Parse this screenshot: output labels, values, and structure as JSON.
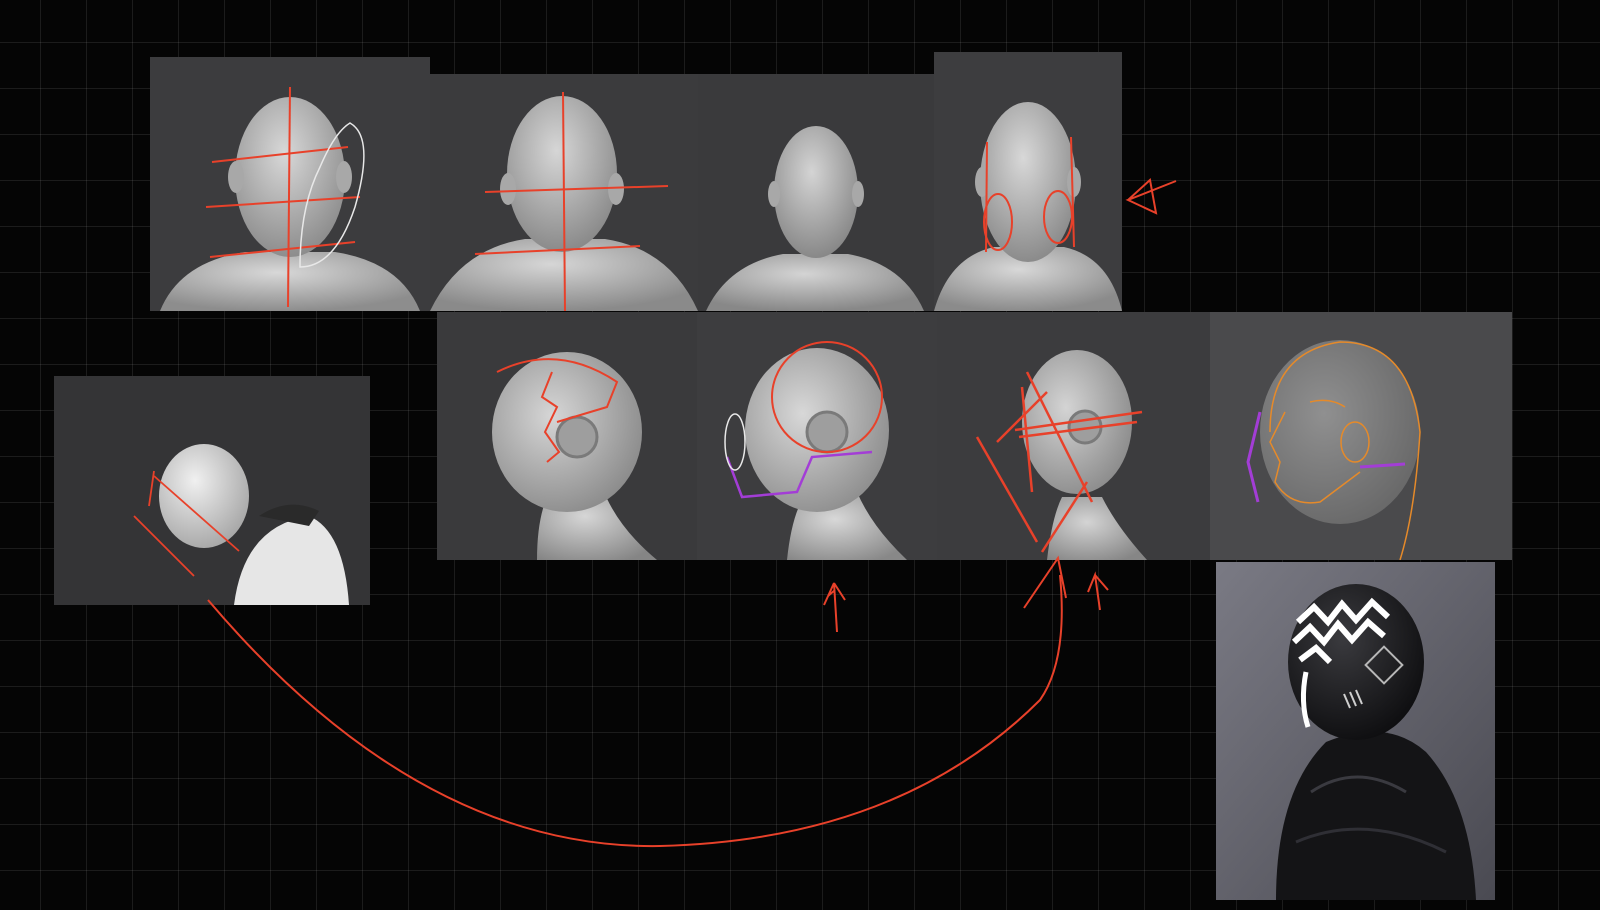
{
  "canvas": {
    "background": "#050505",
    "grid_color": "#262626"
  },
  "colors": {
    "sketch_red": "#e8412a",
    "sketch_white": "#e8e8e8",
    "sketch_purple": "#a33dd6",
    "sketch_orange": "#e58a2a",
    "model_gray": "#c9c9c9",
    "panel_gray": "#3f3f41"
  },
  "panels": [
    {
      "id": "front-view-1",
      "view": "front",
      "annotation": "proportion-lines"
    },
    {
      "id": "front-view-2",
      "view": "front",
      "annotation": "center-cross"
    },
    {
      "id": "front-view-3",
      "view": "front",
      "annotation": "none"
    },
    {
      "id": "front-view-4",
      "view": "front",
      "annotation": "cheek-ovals"
    },
    {
      "id": "side-view-1",
      "view": "side",
      "annotation": "seam-line"
    },
    {
      "id": "side-view-2",
      "view": "side",
      "annotation": "circle-guide"
    },
    {
      "id": "side-view-3",
      "view": "side",
      "annotation": "angle-lines"
    },
    {
      "id": "side-view-4",
      "view": "side",
      "annotation": "xray-anatomy"
    },
    {
      "id": "pose-view",
      "view": "three-quarter-back",
      "annotation": "head-tilt"
    },
    {
      "id": "reference-photo",
      "view": "reference",
      "annotation": "none"
    }
  ],
  "annotations": [
    {
      "id": "pointer-arrow",
      "kind": "arrow",
      "color": "sketch_red"
    },
    {
      "id": "up-arrow-1",
      "kind": "arrow",
      "color": "sketch_red"
    },
    {
      "id": "up-arrow-2",
      "kind": "arrow",
      "color": "sketch_red"
    },
    {
      "id": "connector-curve",
      "kind": "curve",
      "color": "sketch_red"
    }
  ]
}
